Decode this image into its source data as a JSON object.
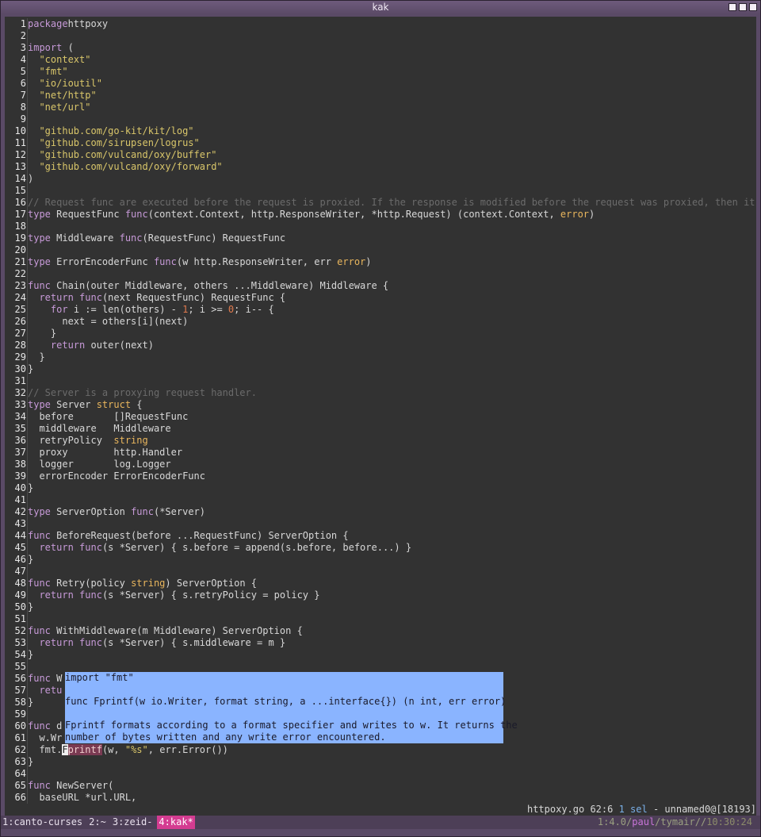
{
  "window": {
    "title": "kak",
    "buttons": [
      "_",
      "□",
      "×"
    ]
  },
  "gutter": [
    "1",
    "2",
    "3",
    "4",
    "5",
    "6",
    "7",
    "8",
    "9",
    "10",
    "11",
    "12",
    "13",
    "14",
    "15",
    "16",
    "17",
    "18",
    "19",
    "20",
    "21",
    "22",
    "23",
    "24",
    "25",
    "26",
    "27",
    "28",
    "29",
    "30",
    "31",
    "32",
    "33",
    "34",
    "35",
    "36",
    "37",
    "38",
    "39",
    "40",
    "41",
    "42",
    "43",
    "44",
    "45",
    "46",
    "47",
    "48",
    "49",
    "50",
    "51",
    "52",
    "53",
    "54",
    "55",
    "56",
    "57",
    "58",
    "59",
    "60",
    "61",
    "62",
    "63",
    "64",
    "65",
    "66"
  ],
  "code_lines": [
    [
      [
        "kw",
        "package"
      ],
      [
        "",
        "httpoxy"
      ]
    ],
    [],
    [
      [
        "kw",
        "import"
      ],
      [
        "",
        " ("
      ]
    ],
    [
      [
        "",
        "  "
      ],
      [
        "str",
        "\"context\""
      ]
    ],
    [
      [
        "",
        "  "
      ],
      [
        "str",
        "\"fmt\""
      ]
    ],
    [
      [
        "",
        "  "
      ],
      [
        "str",
        "\"io/ioutil\""
      ]
    ],
    [
      [
        "",
        "  "
      ],
      [
        "str",
        "\"net/http\""
      ]
    ],
    [
      [
        "",
        "  "
      ],
      [
        "str",
        "\"net/url\""
      ]
    ],
    [],
    [
      [
        "",
        "  "
      ],
      [
        "str",
        "\"github.com/go-kit/kit/log\""
      ]
    ],
    [
      [
        "",
        "  "
      ],
      [
        "str",
        "\"github.com/sirupsen/logrus\""
      ]
    ],
    [
      [
        "",
        "  "
      ],
      [
        "str",
        "\"github.com/vulcand/oxy/buffer\""
      ]
    ],
    [
      [
        "",
        "  "
      ],
      [
        "str",
        "\"github.com/vulcand/oxy/forward\""
      ]
    ],
    [
      [
        "",
        ")"
      ]
    ],
    [],
    [
      [
        "com",
        "// Request func are executed before the request is proxied. If the response is modified before the request was proxied, then it mus"
      ]
    ],
    [
      [
        "kw",
        "type"
      ],
      [
        "",
        " RequestFunc "
      ],
      [
        "kw",
        "func"
      ],
      [
        "",
        "(context.Context, http.ResponseWriter, *http.Request) (context.Context, "
      ],
      [
        "ty",
        "error"
      ],
      [
        "",
        ")"
      ]
    ],
    [],
    [
      [
        "kw",
        "type"
      ],
      [
        "",
        " Middleware "
      ],
      [
        "kw",
        "func"
      ],
      [
        "",
        "(RequestFunc) RequestFunc"
      ]
    ],
    [],
    [
      [
        "kw",
        "type"
      ],
      [
        "",
        " ErrorEncoderFunc "
      ],
      [
        "kw",
        "func"
      ],
      [
        "",
        "(w http.ResponseWriter, err "
      ],
      [
        "ty",
        "error"
      ],
      [
        "",
        ")"
      ]
    ],
    [],
    [
      [
        "kw",
        "func"
      ],
      [
        "",
        " Chain(outer Middleware, others ...Middleware) Middleware {"
      ]
    ],
    [
      [
        "",
        "  "
      ],
      [
        "kw",
        "return"
      ],
      [
        "",
        ""
      ],
      [
        "kw",
        " func"
      ],
      [
        "",
        "(next RequestFunc) RequestFunc {"
      ]
    ],
    [
      [
        "",
        "    "
      ],
      [
        "kw",
        "for"
      ],
      [
        "",
        " i := len(others) - "
      ],
      [
        "num",
        "1"
      ],
      [
        "",
        "; i >= "
      ],
      [
        "num",
        "0"
      ],
      [
        "",
        "; i-- {"
      ]
    ],
    [
      [
        "",
        "      next = others[i](next)"
      ]
    ],
    [
      [
        "",
        "    }"
      ]
    ],
    [
      [
        "",
        "    "
      ],
      [
        "kw",
        "return"
      ],
      [
        "",
        " outer(next)"
      ]
    ],
    [
      [
        "",
        "  }"
      ]
    ],
    [
      [
        "",
        "}"
      ]
    ],
    [],
    [
      [
        "com",
        "// Server is a proxying request handler."
      ]
    ],
    [
      [
        "kw",
        "type"
      ],
      [
        "",
        " Server "
      ],
      [
        "ty",
        "struct"
      ],
      [
        "",
        " {"
      ]
    ],
    [
      [
        "",
        "  before       []RequestFunc"
      ]
    ],
    [
      [
        "",
        "  middleware   Middleware"
      ]
    ],
    [
      [
        "",
        "  retryPolicy  "
      ],
      [
        "ty",
        "string"
      ]
    ],
    [
      [
        "",
        "  proxy        http.Handler"
      ]
    ],
    [
      [
        "",
        "  logger       log.Logger"
      ]
    ],
    [
      [
        "",
        "  errorEncoder ErrorEncoderFunc"
      ]
    ],
    [
      [
        "",
        "}"
      ]
    ],
    [],
    [
      [
        "kw",
        "type"
      ],
      [
        "",
        " ServerOption "
      ],
      [
        "kw",
        "func"
      ],
      [
        "",
        "(*Server)"
      ]
    ],
    [],
    [
      [
        "kw",
        "func"
      ],
      [
        "",
        " BeforeRequest(before ...RequestFunc) ServerOption {"
      ]
    ],
    [
      [
        "",
        "  "
      ],
      [
        "kw",
        "return"
      ],
      [
        "kw",
        " func"
      ],
      [
        "",
        "(s *Server) { s.before = append(s.before, before...) }"
      ]
    ],
    [
      [
        "",
        "}"
      ]
    ],
    [],
    [
      [
        "kw",
        "func"
      ],
      [
        "",
        " Retry(policy "
      ],
      [
        "ty",
        "string"
      ],
      [
        "",
        ") ServerOption {"
      ]
    ],
    [
      [
        "",
        "  "
      ],
      [
        "kw",
        "return"
      ],
      [
        "kw",
        " func"
      ],
      [
        "",
        "(s *Server) { s.retryPolicy = policy }"
      ]
    ],
    [
      [
        "",
        "}"
      ]
    ],
    [],
    [
      [
        "kw",
        "func"
      ],
      [
        "",
        " WithMiddleware(m Middleware) ServerOption {"
      ]
    ],
    [
      [
        "",
        "  "
      ],
      [
        "kw",
        "return"
      ],
      [
        "kw",
        " func"
      ],
      [
        "",
        "(s *Server) { s.middleware = m }"
      ]
    ],
    [
      [
        "",
        "}"
      ]
    ],
    [],
    [
      [
        "kw",
        "func"
      ],
      [
        "",
        " W"
      ]
    ],
    [
      [
        "",
        "  "
      ],
      [
        "kw",
        "retu"
      ]
    ],
    [
      [
        "",
        "}"
      ]
    ],
    [],
    [
      [
        "kw",
        "func"
      ],
      [
        "",
        " d"
      ]
    ],
    [
      [
        "",
        "  w.Wr"
      ]
    ],
    [
      [
        "",
        "  fmt."
      ],
      [
        "cursor",
        "F"
      ],
      [
        "hlfn",
        "printf"
      ],
      [
        "",
        "(w, "
      ],
      [
        "str",
        "\"%s\""
      ],
      [
        "",
        ", err.Error())"
      ]
    ],
    [
      [
        "",
        "}"
      ]
    ],
    [],
    [
      [
        "kw",
        "func"
      ],
      [
        "",
        " NewServer("
      ]
    ],
    [
      [
        "",
        "  baseURL *url.URL,"
      ]
    ]
  ],
  "infobox": {
    "lines": [
      "import \"fmt\"",
      "",
      "func Fprintf(w io.Writer, format string, a ...interface{}) (n int, err error)",
      "",
      "Fprintf formats according to a format specifier and writes to w. It returns the",
      "number of bytes written and any write error encountered."
    ]
  },
  "statusbar": {
    "file": "httpoxy.go",
    "position": "62:6",
    "selection": "1 sel",
    "client": "- unnamed0@[18193]"
  },
  "tmux": {
    "tabs": [
      "1:canto-curses",
      "2:~",
      "3:zeid-",
      "4:kak*"
    ],
    "version": "1:4.0/",
    "user": "paul",
    "host": "/tymair//",
    "time": "10:30:24"
  }
}
